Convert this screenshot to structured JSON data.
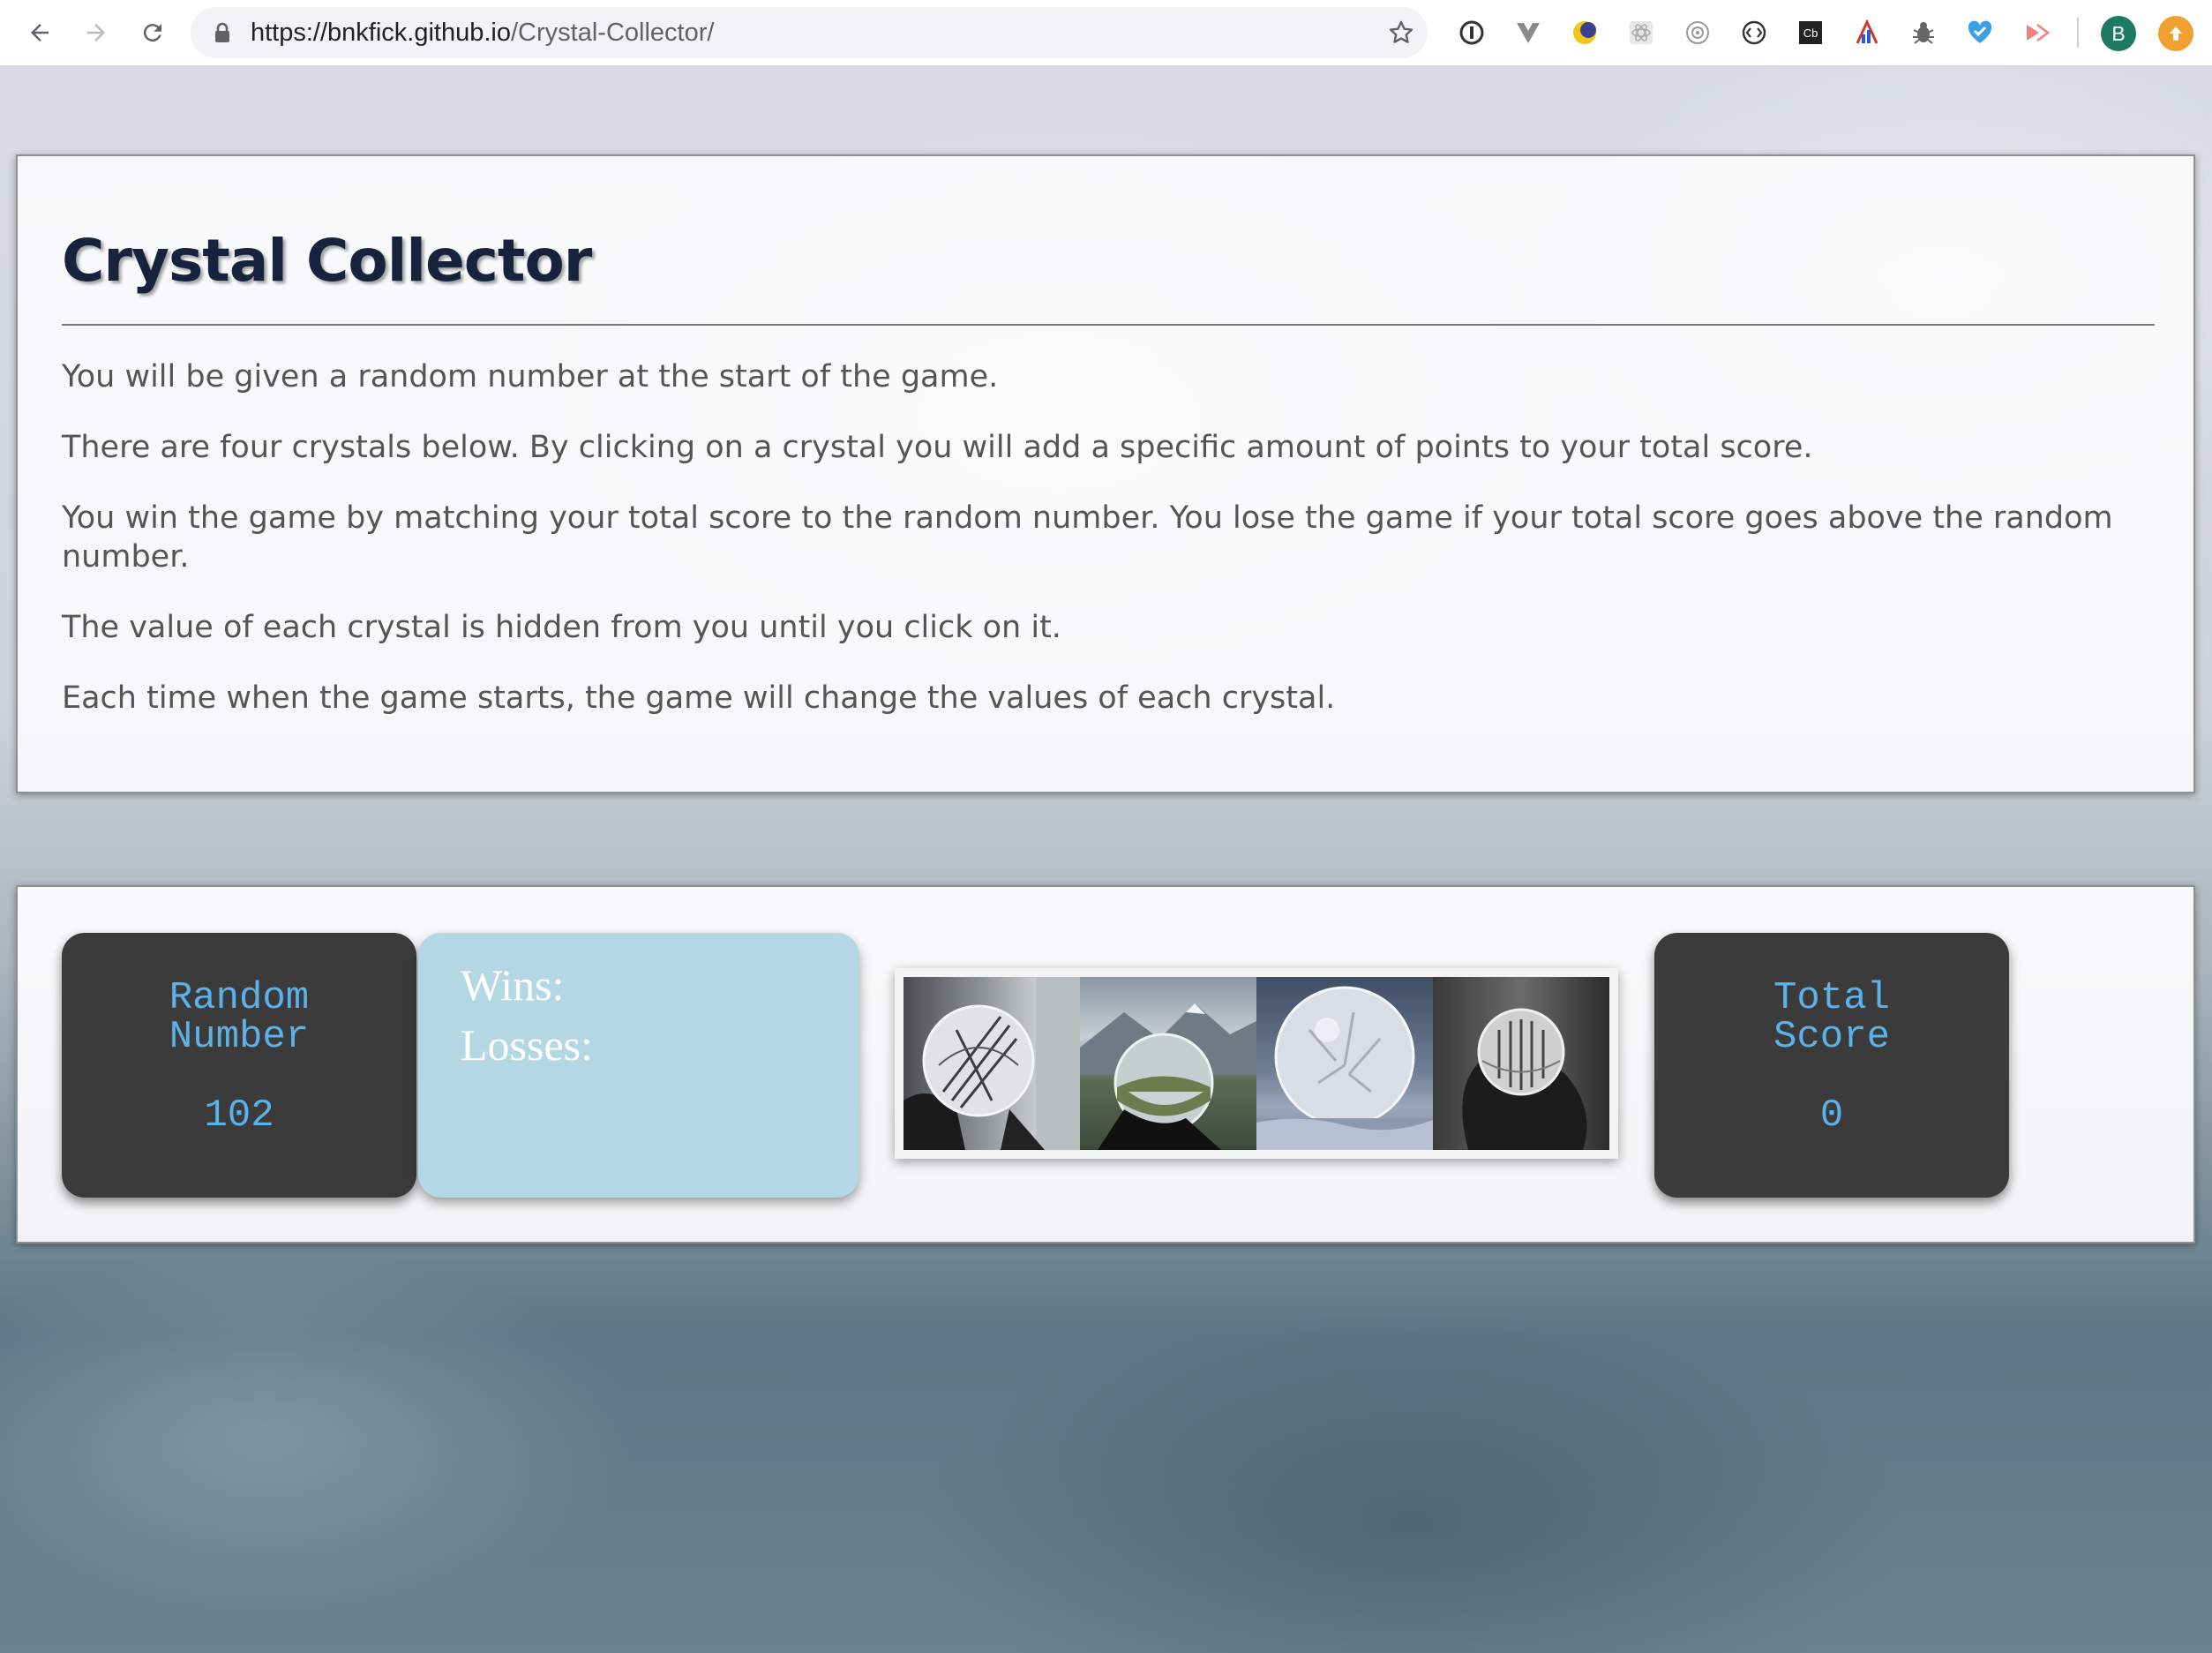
{
  "browser": {
    "url_host": "https://bnkfick.github.io",
    "url_path": "/Crystal-Collector/",
    "profile_initial": "B",
    "icons": [
      "back-arrow-icon",
      "forward-arrow-icon",
      "reload-icon",
      "lock-icon",
      "star-icon"
    ]
  },
  "intro": {
    "title": "Crystal Collector",
    "paragraphs": [
      "You will be given a random number at the start of the game.",
      "There are four crystals below. By clicking on a crystal you will add a specific amount of points to your total score.",
      "You win the game by matching your total score to the random number. You lose the game if your total score goes above the random number.",
      "The value of each crystal is hidden from you until you click on it.",
      "Each time when the game starts, the game will change the values of each crystal."
    ]
  },
  "game": {
    "random_label_line1": "Random",
    "random_label_line2": "Number",
    "random_value": "102",
    "wins_label": "Wins:",
    "losses_label": "Losses:",
    "total_label_line1": "Total",
    "total_label_line2": "Score",
    "total_value": "0",
    "crystals": [
      {
        "name": "crystal-ball-bridge"
      },
      {
        "name": "crystal-ball-mountains"
      },
      {
        "name": "frozen-bubble"
      },
      {
        "name": "crystal-ball-forest"
      }
    ]
  },
  "colors": {
    "title": "#17233d",
    "card_dark": "#3b3b3b",
    "card_text": "#5ab2e8",
    "winloss_bg": "#b4d7e4"
  }
}
